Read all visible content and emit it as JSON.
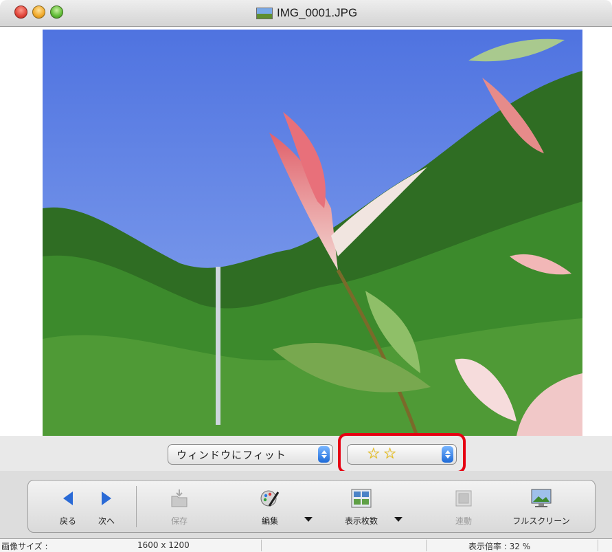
{
  "window": {
    "title": "IMG_0001.JPG"
  },
  "zoom_popup": {
    "label": "ウィンドウにフィット"
  },
  "rating_popup": {
    "stars": 2
  },
  "toolbar": {
    "back": "戻る",
    "next": "次へ",
    "save": "保存",
    "edit": "編集",
    "display_count": "表示枚数",
    "sync": "連動",
    "fullscreen": "フルスクリーン"
  },
  "status": {
    "image_size_label": "画像サイズ :",
    "image_size_value": "1600 x 1200",
    "zoom_text": "表示倍率 : 32 %"
  },
  "colors": {
    "highlight": "#e60012",
    "sky": "#6a8ee8",
    "popup_arrows": "#2a72dc"
  }
}
